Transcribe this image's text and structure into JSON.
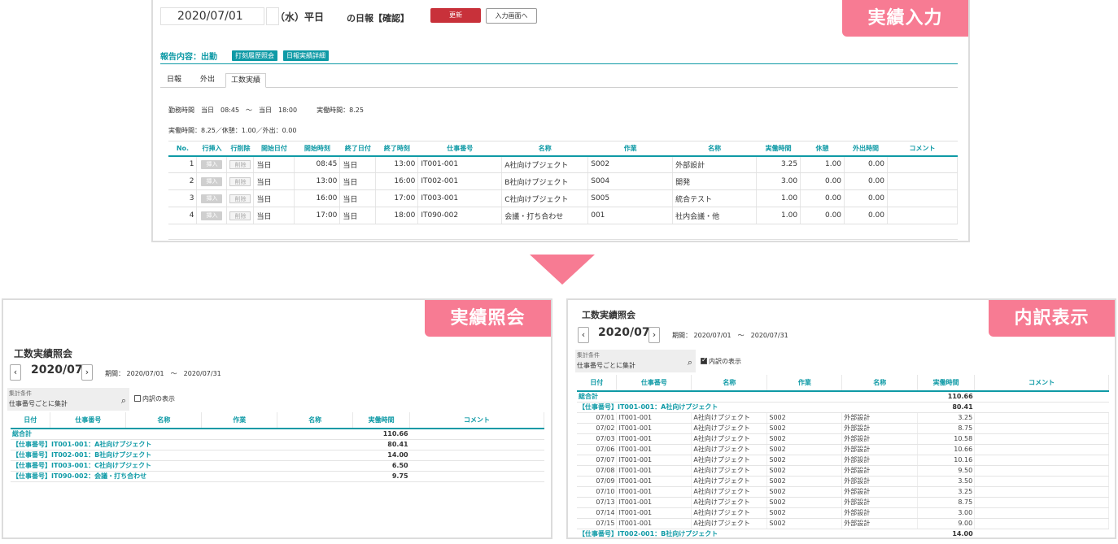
{
  "entry": {
    "tag": "実績入力",
    "date": "2020/07/01",
    "weekday": "（水）平日",
    "report_title": "の日報【確認】",
    "update_label": "更新",
    "goto_input_label": "入力画面へ",
    "report_content": "報告内容：出勤",
    "history_btn": "打刻履歴照会",
    "daily_detail_btn": "日報実績詳細",
    "tabs": [
      "日報",
      "外出",
      "工数実績"
    ],
    "work_time_line": "勤務時間　当日　08:45　～　当日　18:00　　　実働時間：8.25",
    "summary_line": "実働時間：8.25／休憩：1.00／外出：0.00",
    "headers": [
      "No.",
      "行挿入",
      "行削除",
      "開始日付",
      "開始時刻",
      "終了日付",
      "終了時刻",
      "仕事番号",
      "名称",
      "作業",
      "名称",
      "実働時間",
      "休憩",
      "外出時間",
      "コメント"
    ],
    "insert_label": "挿入",
    "delete_label": "削除",
    "rows": [
      {
        "no": "1",
        "sd": "当日",
        "st": "08:45",
        "ed": "当日",
        "et": "13:00",
        "job": "IT001-001",
        "name": "A社向けプジェクト",
        "task": "S002",
        "tname": "外部設計",
        "work": "3.25",
        "rest": "1.00",
        "out": "0.00"
      },
      {
        "no": "2",
        "sd": "当日",
        "st": "13:00",
        "ed": "当日",
        "et": "16:00",
        "job": "IT002-001",
        "name": "B社向けプジェクト",
        "task": "S004",
        "tname": "開発",
        "work": "3.00",
        "rest": "0.00",
        "out": "0.00"
      },
      {
        "no": "3",
        "sd": "当日",
        "st": "16:00",
        "ed": "当日",
        "et": "17:00",
        "job": "IT003-001",
        "name": "C社向けプジェクト",
        "task": "S005",
        "tname": "統合テスト",
        "work": "1.00",
        "rest": "0.00",
        "out": "0.00"
      },
      {
        "no": "4",
        "sd": "当日",
        "st": "17:00",
        "ed": "当日",
        "et": "18:00",
        "job": "IT090-002",
        "name": "会議・打ち合わせ",
        "task": "001",
        "tname": "社内会議・他",
        "work": "1.00",
        "rest": "0.00",
        "out": "0.00"
      }
    ]
  },
  "inquiry": {
    "tag": "実績照会",
    "title": "工数実績照会",
    "month": "2020/07",
    "period": "期間： 2020/07/01　～　2020/07/31",
    "search_label": "集計条件",
    "search_value": "仕事番号ごとに集計",
    "breakdown_label": "内訳の表示",
    "headers": [
      "日付",
      "仕事番号",
      "名称",
      "作業",
      "名称",
      "実働時間",
      "コメント"
    ],
    "total_label": "総合計",
    "total_value": "110.66",
    "groups": [
      {
        "label": "【仕事番号】IT001-001：A社向けプジェクト",
        "value": "80.41"
      },
      {
        "label": "【仕事番号】IT002-001：B社向けプジェクト",
        "value": "14.00"
      },
      {
        "label": "【仕事番号】IT003-001：C社向けプジェクト",
        "value": "6.50"
      },
      {
        "label": "【仕事番号】IT090-002：会議・打ち合わせ",
        "value": "9.75"
      }
    ]
  },
  "breakdown": {
    "tag": "内訳表示",
    "title": "工数実績照会",
    "month": "2020/07",
    "period": "期間： 2020/07/01　～　2020/07/31",
    "search_label": "集計条件",
    "search_value": "仕事番号ごとに集計",
    "breakdown_label": "内訳の表示",
    "headers": [
      "日付",
      "仕事番号",
      "名称",
      "作業",
      "名称",
      "実働時間",
      "コメント"
    ],
    "total_label": "総合計",
    "total_value": "110.66",
    "group1_label": "【仕事番号】IT001-001：A社向けプジェクト",
    "group1_value": "80.41",
    "group2_label": "【仕事番号】IT002-001：B社向けプジェクト",
    "group2_value": "14.00",
    "detail_job": "IT001-001",
    "detail_name": "A社向けプジェクト",
    "detail_task": "S002",
    "detail_tname": "外部設計",
    "details": [
      {
        "date": "07/01",
        "value": "3.25"
      },
      {
        "date": "07/02",
        "value": "8.75"
      },
      {
        "date": "07/03",
        "value": "10.58"
      },
      {
        "date": "07/06",
        "value": "10.66"
      },
      {
        "date": "07/07",
        "value": "10.16"
      },
      {
        "date": "07/08",
        "value": "9.50"
      },
      {
        "date": "07/09",
        "value": "3.50"
      },
      {
        "date": "07/10",
        "value": "3.25"
      },
      {
        "date": "07/13",
        "value": "8.75"
      },
      {
        "date": "07/14",
        "value": "3.00"
      },
      {
        "date": "07/15",
        "value": "9.00"
      }
    ]
  },
  "colors": {
    "teal": "#0f9aa6",
    "pink": "#f77b93",
    "red": "#c8313a"
  }
}
